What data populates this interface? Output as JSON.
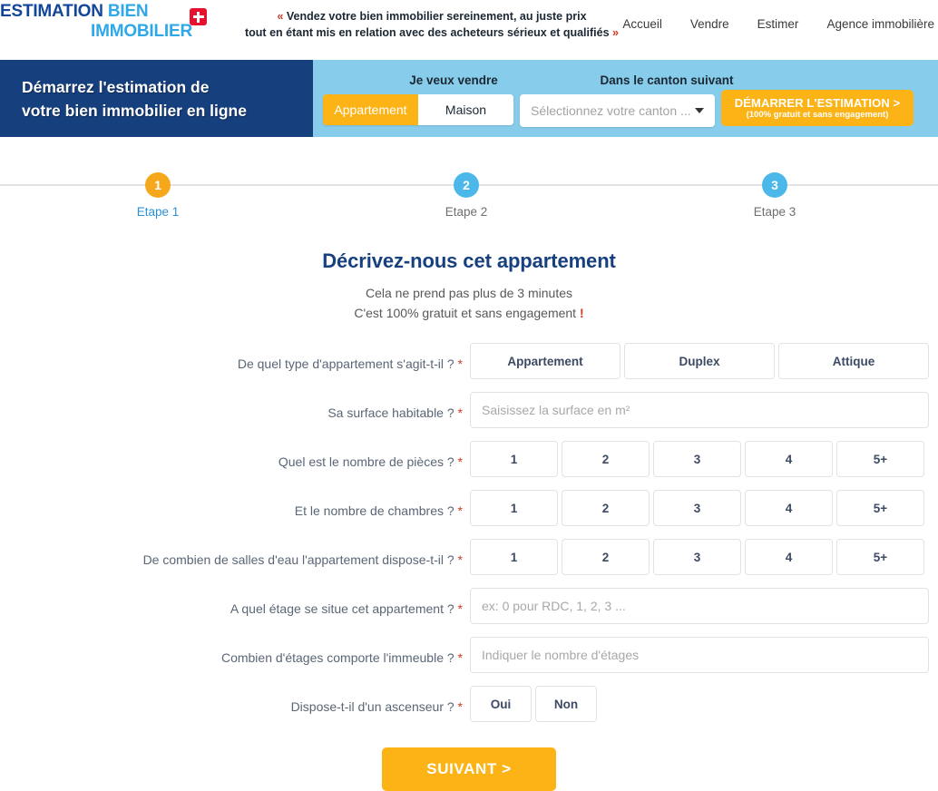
{
  "header": {
    "brand": {
      "word1": "ESTIMATION ",
      "word2": "BIEN",
      "line2": "IMMOBILIER",
      "flag_icon": "swiss-flag-icon"
    },
    "tagline_line1": "Vendez votre bien immobilier sereinement, au juste prix",
    "tagline_line2": "tout en étant mis en relation avec des acheteurs sérieux et qualifiés",
    "quote_open": "«",
    "quote_close": "»",
    "nav": [
      {
        "label": "Accueil"
      },
      {
        "label": "Vendre"
      },
      {
        "label": "Estimer"
      },
      {
        "label": "Agence immobilière"
      }
    ]
  },
  "hero": {
    "headline_line1": "Démarrez l'estimation de",
    "headline_line2": "votre bien immobilier en ligne",
    "sell_label": "Je veux vendre",
    "canton_label": "Dans le canton suivant",
    "property_types": [
      {
        "label": "Appartement",
        "selected": true
      },
      {
        "label": "Maison",
        "selected": false
      }
    ],
    "canton_placeholder": "Sélectionnez votre canton ...",
    "canton_value": "",
    "cta_main": "DÉMARRER L'ESTIMATION >",
    "cta_sub": "(100% gratuit et sans engagement)",
    "colors": {
      "banner": "#163f7e",
      "strip": "#87cdeb",
      "accent": "#fcb316"
    }
  },
  "stepper": {
    "steps": [
      {
        "number": "1",
        "label": "Etape 1",
        "active": true
      },
      {
        "number": "2",
        "label": "Etape 2",
        "active": false
      },
      {
        "number": "3",
        "label": "Etape 3",
        "active": false
      }
    ],
    "active_color": "#f5a81c",
    "inactive_color": "#4cb8ea"
  },
  "form": {
    "title": "Décrivez-nous cet appartement",
    "sub_line1": "Cela ne prend pas plus de 3 minutes",
    "sub_line2": "C'est 100% gratuit et sans engagement ",
    "sub_exclaim": "!",
    "required_marker": "*",
    "rows": [
      {
        "label": "De quel type d'appartement s'agit-t-il ?",
        "type": "options-3",
        "options": [
          "Appartement",
          "Duplex",
          "Attique"
        ]
      },
      {
        "label": "Sa surface habitable ?",
        "type": "text",
        "placeholder": "Saisissez la surface en m²",
        "value": ""
      },
      {
        "label": "Quel est le nombre de pièces ?",
        "type": "options-5",
        "options": [
          "1",
          "2",
          "3",
          "4",
          "5+"
        ]
      },
      {
        "label": "Et le nombre de chambres ?",
        "type": "options-5",
        "options": [
          "1",
          "2",
          "3",
          "4",
          "5+"
        ]
      },
      {
        "label": "De combien de salles d'eau l'appartement dispose-t-il ?",
        "type": "options-5",
        "options": [
          "1",
          "2",
          "3",
          "4",
          "5+"
        ]
      },
      {
        "label": "A quel étage se situe cet appartement ?",
        "type": "text",
        "placeholder": "ex: 0 pour RDC, 1, 2, 3 ...",
        "value": ""
      },
      {
        "label": "Combien d'étages comporte l'immeuble ?",
        "type": "text",
        "placeholder": "Indiquer le nombre d'étages",
        "value": ""
      },
      {
        "label": "Dispose-t-il d'un ascenseur ?",
        "type": "options-2",
        "options": [
          "Oui",
          "Non"
        ]
      }
    ],
    "submit_label": "SUIVANT  >"
  }
}
